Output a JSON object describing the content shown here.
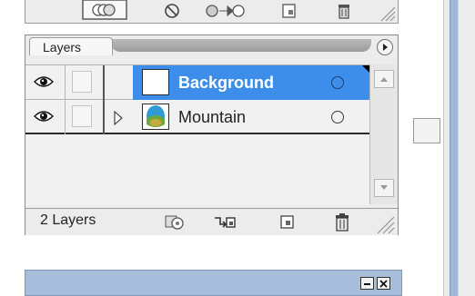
{
  "panel": {
    "tab_label": "Layers",
    "footer_count": "2 Layers"
  },
  "layers": [
    {
      "name": "Background",
      "selected": true,
      "visible": true
    },
    {
      "name": "Mountain",
      "selected": false,
      "visible": true
    }
  ],
  "colors": {
    "selection": "#3d8eea",
    "panel_bg": "#ececec",
    "title_bar": "#a6bedb"
  },
  "icons": {
    "top": [
      "clipping-mask-icon",
      "no-entry-icon",
      "add-sublayer-icon",
      "new-layer-icon",
      "delete-icon"
    ],
    "footer": [
      "clipping-mask-icon",
      "new-sublayer-icon",
      "new-layer-icon",
      "delete-icon"
    ]
  }
}
